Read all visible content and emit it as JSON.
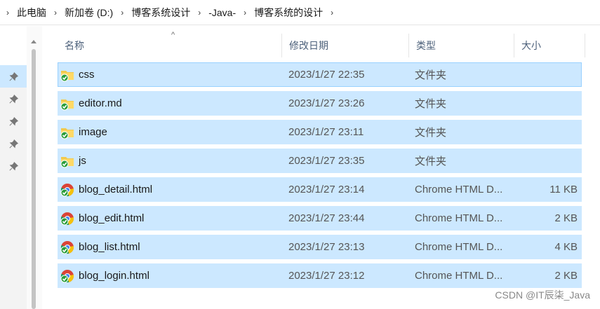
{
  "breadcrumb": [
    "此电脑",
    "新加卷 (D:)",
    "博客系统设计",
    "-Java-",
    "博客系统的设计"
  ],
  "columns": {
    "name": "名称",
    "date": "修改日期",
    "type": "类型",
    "size": "大小"
  },
  "files": [
    {
      "name": "css",
      "date": "2023/1/27 22:35",
      "type": "文件夹",
      "size": "",
      "icon": "folder-icon"
    },
    {
      "name": "editor.md",
      "date": "2023/1/27 23:26",
      "type": "文件夹",
      "size": "",
      "icon": "folder-icon"
    },
    {
      "name": "image",
      "date": "2023/1/27 23:11",
      "type": "文件夹",
      "size": "",
      "icon": "folder-icon"
    },
    {
      "name": "js",
      "date": "2023/1/27 23:35",
      "type": "文件夹",
      "size": "",
      "icon": "folder-icon"
    },
    {
      "name": "blog_detail.html",
      "date": "2023/1/27 23:14",
      "type": "Chrome HTML D...",
      "size": "11 KB",
      "icon": "chrome-icon"
    },
    {
      "name": "blog_edit.html",
      "date": "2023/1/27 23:44",
      "type": "Chrome HTML D...",
      "size": "2 KB",
      "icon": "chrome-icon"
    },
    {
      "name": "blog_list.html",
      "date": "2023/1/27 23:13",
      "type": "Chrome HTML D...",
      "size": "4 KB",
      "icon": "chrome-icon"
    },
    {
      "name": "blog_login.html",
      "date": "2023/1/27 23:12",
      "type": "Chrome HTML D...",
      "size": "2 KB",
      "icon": "chrome-icon"
    }
  ],
  "watermark": "CSDN @IT辰柒_Java"
}
